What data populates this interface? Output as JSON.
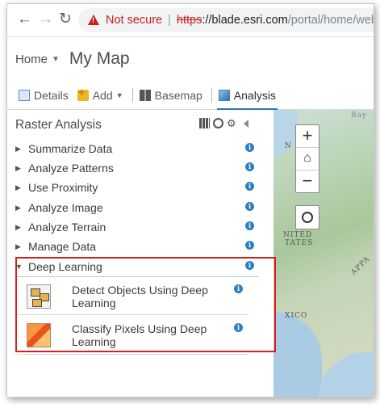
{
  "browser": {
    "back_icon": "arrow-left-icon",
    "forward_icon": "arrow-right-icon",
    "reload_icon": "reload-icon",
    "security_label": "Not secure",
    "url_scheme": "https",
    "url_host": "://blade.esri.com",
    "url_path": "/portal/home/web"
  },
  "header": {
    "home": "Home",
    "title": "My Map"
  },
  "toolbar": {
    "details": "Details",
    "add": "Add",
    "basemap": "Basemap",
    "analysis": "Analysis"
  },
  "panel": {
    "title": "Raster Analysis",
    "categories": [
      {
        "label": "Summarize Data"
      },
      {
        "label": "Analyze Patterns"
      },
      {
        "label": "Use Proximity"
      },
      {
        "label": "Analyze Image"
      },
      {
        "label": "Analyze Terrain"
      },
      {
        "label": "Manage Data"
      },
      {
        "label": "Deep Learning"
      }
    ],
    "tools": [
      {
        "label": "Detect Objects Using Deep Learning"
      },
      {
        "label": "Classify Pixels Using Deep Learning"
      }
    ],
    "info_glyph": "i"
  },
  "map": {
    "labels": [
      "Bay",
      "N",
      "NITED",
      "TATES",
      "APPA",
      "XICO"
    ],
    "zoom_in": "+",
    "zoom_out": "−"
  },
  "colors": {
    "accent": "#2978b5",
    "highlight": "#d91e1e",
    "not_secure": "#c5221f"
  }
}
